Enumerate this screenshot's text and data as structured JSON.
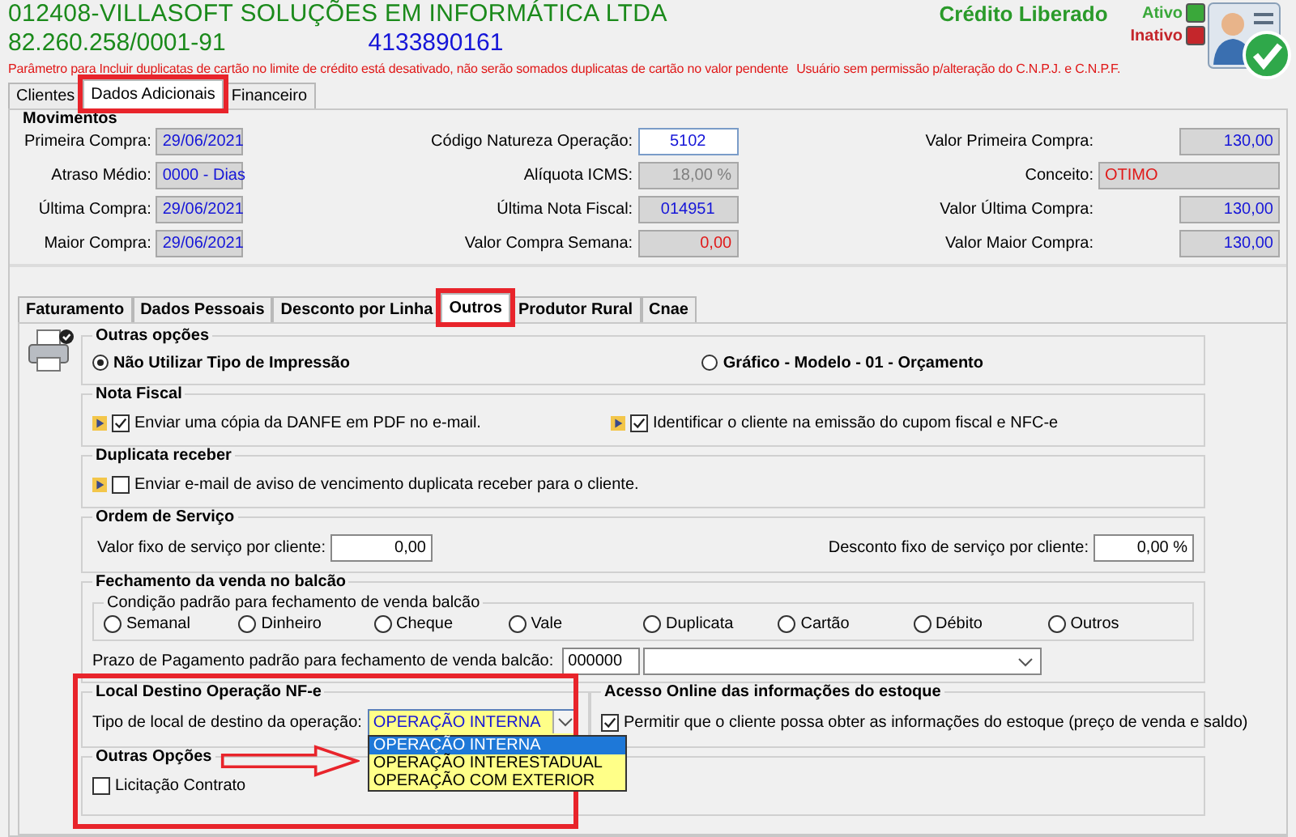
{
  "header": {
    "company": "012408-VILLASOFT SOLUÇÕES EM INFORMÁTICA LTDA",
    "cnpj": "82.260.258/0001-91",
    "phone": "4133890161",
    "credit_status": "Crédito Liberado",
    "status_legend": [
      {
        "label": "Ativo",
        "color": "#3aa83a"
      },
      {
        "label": "Inativo",
        "color": "#c4262b"
      }
    ],
    "warnings": [
      "Parâmetro para Incluir duplicatas de cartão no limite de crédito está desativado, não serão somados duplicatas de cartão no valor pendente",
      "Usuário sem permissão p/alteração do C.N.P.J.  e C.N.P.F."
    ]
  },
  "top_tabs": [
    {
      "label": "Clientes",
      "selected": false,
      "annotated": false
    },
    {
      "label": "Dados Adicionais",
      "selected": true,
      "annotated": true
    },
    {
      "label": "Financeiro",
      "selected": false,
      "annotated": false
    }
  ],
  "movimentos": {
    "title": "Movimentos",
    "columns": [
      [
        {
          "label": "Primeira Compra:",
          "value": "29/06/2021",
          "kind": "date",
          "editable": false,
          "alert": false
        },
        {
          "label": "Atraso Médio:",
          "value": "0000 - Dias",
          "kind": "date",
          "editable": false,
          "alert": false
        },
        {
          "label": "Última Compra:",
          "value": "29/06/2021",
          "kind": "date",
          "editable": false,
          "alert": false
        },
        {
          "label": "Maior Compra:",
          "value": "29/06/2021",
          "kind": "date",
          "editable": false,
          "alert": false
        }
      ],
      [
        {
          "label": "Código Natureza Operação:",
          "value": "5102",
          "kind": "date",
          "editable": true,
          "alert": false
        },
        {
          "label": "Alíquota ICMS:",
          "value": "18,00 %",
          "kind": "percent",
          "editable": false,
          "alert": false
        },
        {
          "label": "Última Nota Fiscal:",
          "value": "014951",
          "kind": "date",
          "editable": false,
          "alert": false
        },
        {
          "label": "Valor Compra Semana:",
          "value": "0,00",
          "kind": "amount",
          "editable": false,
          "alert": true
        }
      ],
      [
        {
          "label": "Valor Primeira Compra:",
          "value": "130,00",
          "kind": "amount",
          "editable": false,
          "alert": false
        },
        {
          "label": "Conceito:",
          "value": "OTIMO",
          "kind": "text",
          "editable": false,
          "alert": true
        },
        {
          "label": "Valor Última Compra:",
          "value": "130,00",
          "kind": "amount",
          "editable": false,
          "alert": false
        },
        {
          "label": "Valor Maior Compra:",
          "value": "130,00",
          "kind": "amount",
          "editable": false,
          "alert": false
        }
      ]
    ]
  },
  "inner_tabs": [
    {
      "label": "Faturamento",
      "selected": false,
      "annotated": false
    },
    {
      "label": "Dados Pessoais",
      "selected": false,
      "annotated": false
    },
    {
      "label": "Desconto por Linha",
      "selected": false,
      "annotated": false
    },
    {
      "label": "Outros",
      "selected": true,
      "annotated": true
    },
    {
      "label": "Produtor Rural",
      "selected": false,
      "annotated": false
    },
    {
      "label": "Cnae",
      "selected": false,
      "annotated": false
    }
  ],
  "outras_opcoes": {
    "title": "Outras opções",
    "radios": [
      {
        "label": "Não Utilizar Tipo de Impressão",
        "selected": true
      },
      {
        "label": "Gráfico - Modelo - 01 - Orçamento",
        "selected": false
      }
    ]
  },
  "nota_fiscal": {
    "title": "Nota Fiscal",
    "checks": [
      {
        "label": "Enviar uma cópia da DANFE em PDF no e-mail.",
        "checked": true
      },
      {
        "label": "Identificar o cliente na emissão do cupom fiscal e NFC-e",
        "checked": true
      }
    ]
  },
  "duplicata_receber": {
    "title": "Duplicata receber",
    "checks": [
      {
        "label": "Enviar e-mail de aviso de vencimento duplicata receber para o cliente.",
        "checked": false
      }
    ]
  },
  "ordem_servico": {
    "title": "Ordem de Serviço",
    "fields": [
      {
        "label": "Valor fixo de serviço por cliente:",
        "value": "0,00"
      },
      {
        "label": "Desconto fixo de serviço por cliente:",
        "value": "0,00 %"
      }
    ]
  },
  "fechamento": {
    "title": "Fechamento da venda no balcão",
    "condition_title": "Condição padrão para fechamento de venda balcão",
    "radios": [
      {
        "label": "Semanal",
        "selected": false
      },
      {
        "label": "Dinheiro",
        "selected": false
      },
      {
        "label": "Cheque",
        "selected": false
      },
      {
        "label": "Vale",
        "selected": false
      },
      {
        "label": "Duplicata",
        "selected": false
      },
      {
        "label": "Cartão",
        "selected": false
      },
      {
        "label": "Débito",
        "selected": false
      },
      {
        "label": "Outros",
        "selected": false
      }
    ],
    "term_label": "Prazo de Pagamento padrão para fechamento de venda balcão:",
    "term_code": "000000"
  },
  "local_destino": {
    "title": "Local Destino Operação NF-e",
    "label": "Tipo de local de destino da operação:",
    "value": "OPERAÇÃO INTERNA",
    "expanded": true,
    "annotated": true,
    "options": [
      {
        "label": "OPERAÇÃO INTERNA",
        "selected": true
      },
      {
        "label": "OPERAÇÃO INTERESTADUAL",
        "selected": false
      },
      {
        "label": "OPERAÇÃO COM EXTERIOR",
        "selected": false
      }
    ]
  },
  "acesso_online": {
    "title": "Acesso Online das informações do estoque",
    "checks": [
      {
        "label": "Permitir que o cliente possa obter as informações do estoque (preço de venda e saldo)",
        "checked": true
      }
    ]
  },
  "outras_opcoes_2": {
    "title": "Outras Opções",
    "checks": [
      {
        "label": "Licitação Contrato",
        "checked": false
      }
    ]
  }
}
